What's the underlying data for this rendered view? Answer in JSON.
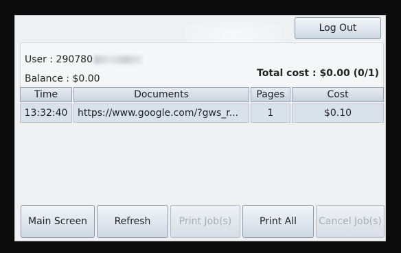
{
  "header": {
    "logout_label": "Log Out"
  },
  "info": {
    "user_label": "User : ",
    "user_id_visible": "290780",
    "balance": "Balance : $0.00",
    "total": "Total cost : $0.00  (0/1)"
  },
  "table": {
    "headers": [
      "Time",
      "Documents",
      "Pages",
      "Cost"
    ],
    "rows": [
      {
        "time": "13:32:40",
        "document": "https://www.google.com/?gws_r...",
        "pages": "1",
        "cost": "$0.10"
      }
    ]
  },
  "footer": {
    "main_screen": "Main Screen",
    "refresh": "Refresh",
    "print_jobs": "Print Job(s)",
    "print_all": "Print All",
    "cancel_jobs": "Cancel Job(s)"
  }
}
